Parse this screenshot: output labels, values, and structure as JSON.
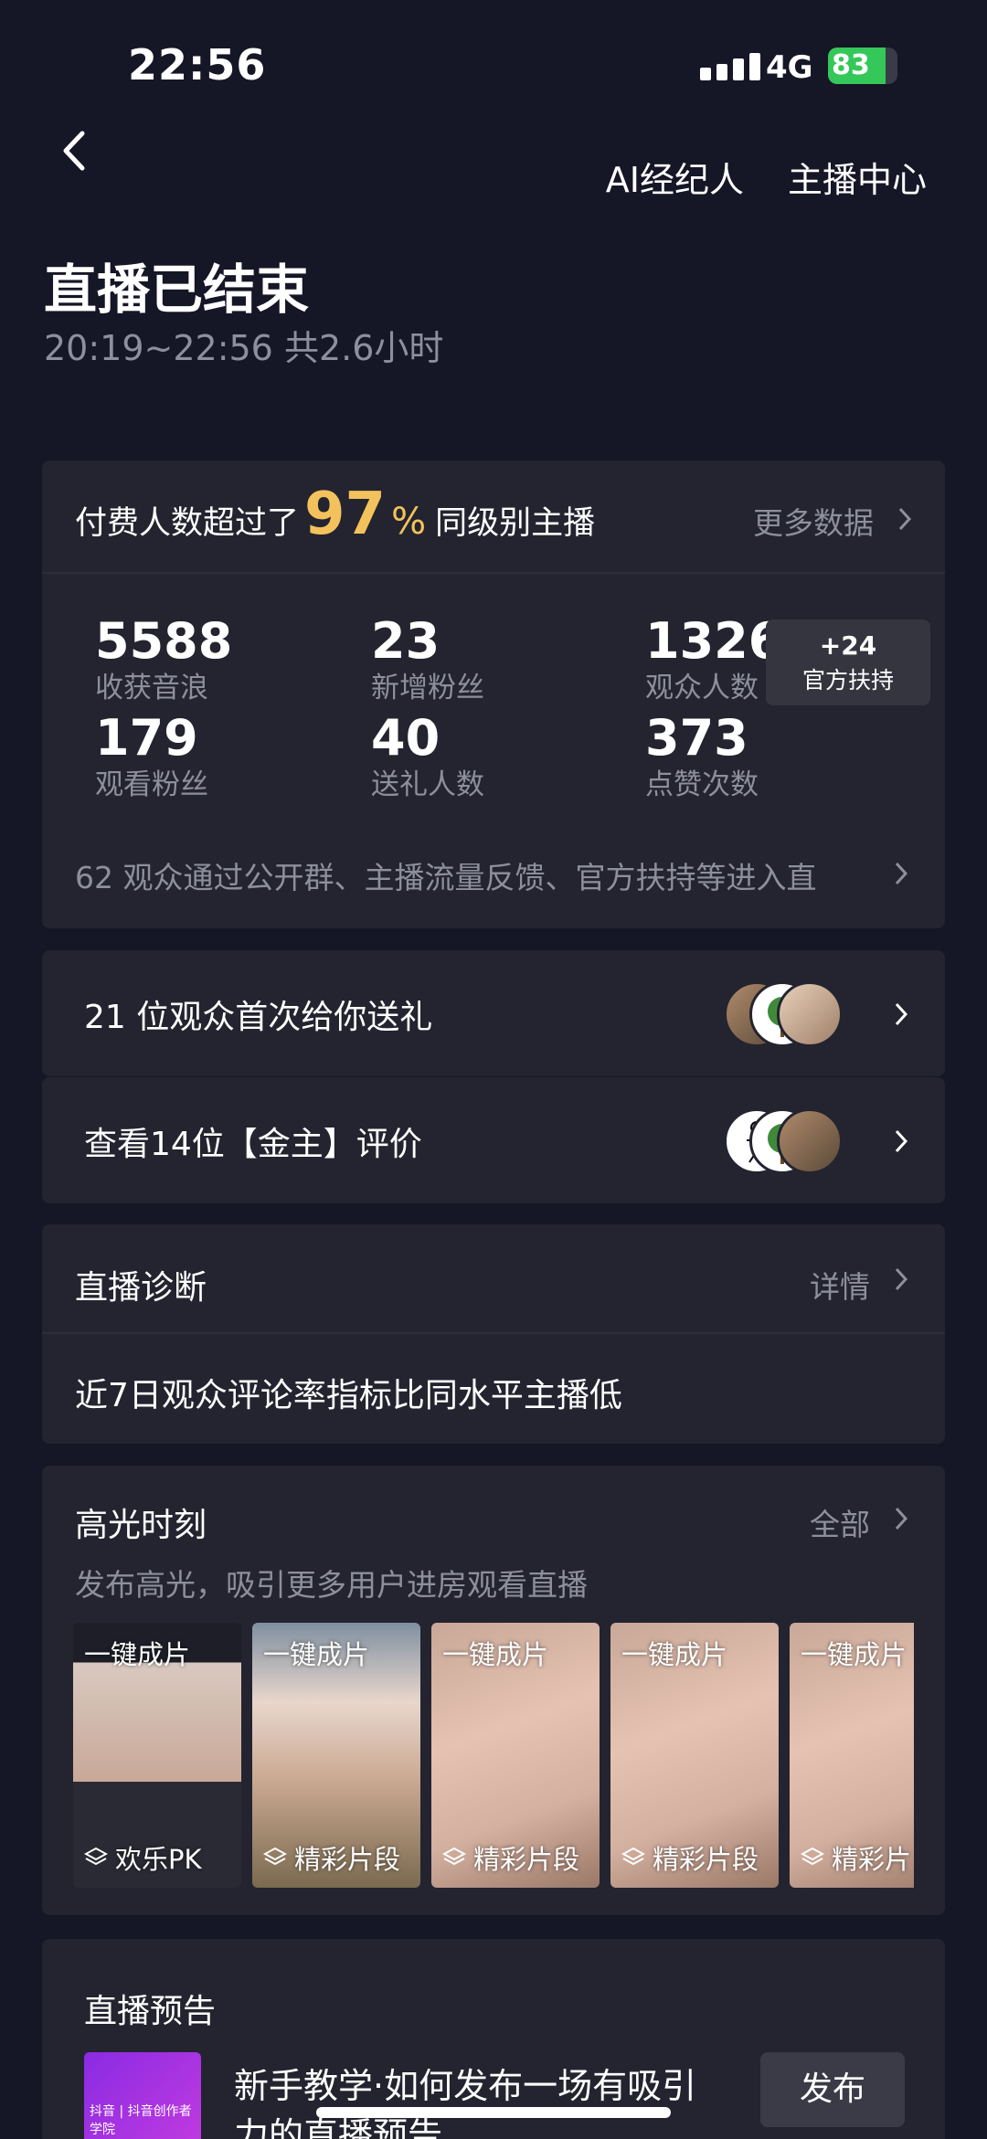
{
  "status": {
    "time": "22:56",
    "network": "4G",
    "battery": "83",
    "battery_level": 0.83
  },
  "nav": {
    "ai_agent": "AI经纪人",
    "anchor_center": "主播中心"
  },
  "header": {
    "title": "直播已结束",
    "subtitle": "20:19~22:56 共2.6小时"
  },
  "summary": {
    "prefix": "付费人数超过了",
    "percent": "97",
    "percent_sign": "%",
    "suffix": "同级别主播",
    "more_data": "更多数据",
    "stats": [
      {
        "value": "5588",
        "label": "收获音浪"
      },
      {
        "value": "23",
        "label": "新增粉丝"
      },
      {
        "value": "1326",
        "label": "观众人数"
      },
      {
        "value": "179",
        "label": "观看粉丝"
      },
      {
        "value": "40",
        "label": "送礼人数"
      },
      {
        "value": "373",
        "label": "点赞次数"
      }
    ],
    "badge_value": "+24",
    "badge_label": "官方扶持",
    "footer": "62 观众通过公开群、主播流量反馈、官方扶持等进入直"
  },
  "first_gift": {
    "text": "21 位观众首次给你送礼"
  },
  "sponsor_review": {
    "text": "查看14位【金主】评价"
  },
  "diagnosis": {
    "title": "直播诊断",
    "detail": "详情",
    "body": "近7日观众评论率指标比同水平主播低"
  },
  "highlights": {
    "title": "高光时刻",
    "all": "全部",
    "subtitle": "发布高光，吸引更多用户进房观看直播",
    "items": [
      {
        "tag": "一键成片",
        "caption": "欢乐PK"
      },
      {
        "tag": "一键成片",
        "caption": "精彩片段"
      },
      {
        "tag": "一键成片",
        "caption": "精彩片段"
      },
      {
        "tag": "一键成片",
        "caption": "精彩片段"
      },
      {
        "tag": "一键成片",
        "caption": "精彩片"
      }
    ]
  },
  "preview": {
    "title": "直播预告",
    "thumb_text": "抖音 | 抖音创作者学院",
    "text": "新手教学·如何发布一场有吸引力的直播预告",
    "publish": "发布"
  }
}
